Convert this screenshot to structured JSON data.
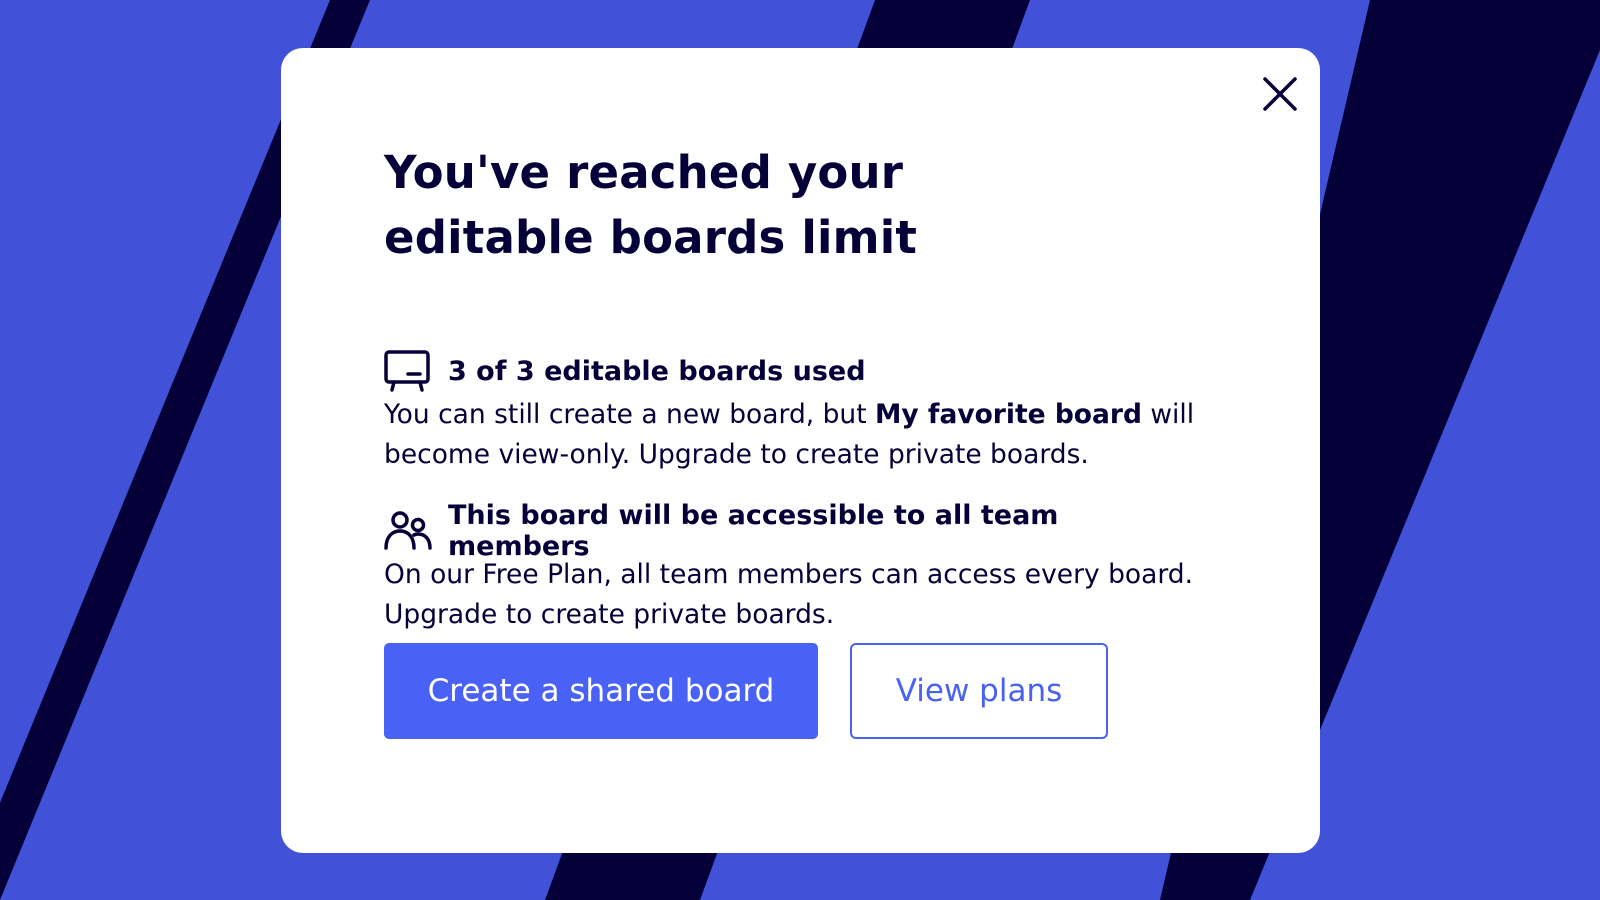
{
  "colors": {
    "background_blue": "#4152d8",
    "background_stripe": "#050038",
    "modal_bg": "#ffffff",
    "text_dark": "#050038",
    "accent": "#4961f5"
  },
  "modal": {
    "title": "You've reached your editable boards limit",
    "close_icon": "close-icon",
    "sections": [
      {
        "icon": "board-icon",
        "heading": "3 of 3 editable boards used",
        "text_before": "You can still create a new board, but ",
        "text_bold": "My favorite board",
        "text_after": " will become view-only. Upgrade to create private boards."
      },
      {
        "icon": "team-members-icon",
        "heading": "This board will be accessible to all team members",
        "text": "On our Free Plan, all team members can access every board. Upgrade to create private boards."
      }
    ],
    "buttons": {
      "primary_label": "Create a shared board",
      "secondary_label": "View plans"
    }
  }
}
